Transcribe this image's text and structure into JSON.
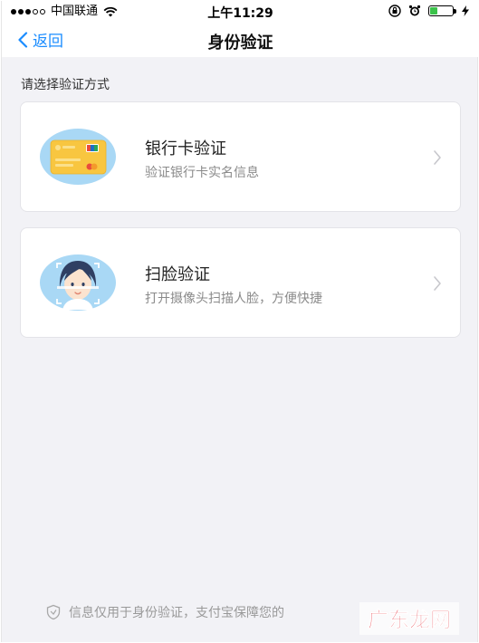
{
  "status_bar": {
    "carrier": "中国联通",
    "time": "上午11:29",
    "battery_level": 0.35,
    "icons": [
      "signal-icon",
      "wifi-icon",
      "orientation-lock-icon",
      "alarm-icon",
      "battery-icon",
      "charging-icon"
    ]
  },
  "nav": {
    "back_label": "返回",
    "title": "身份验证"
  },
  "section": {
    "label": "请选择验证方式"
  },
  "options": [
    {
      "title": "银行卡验证",
      "subtitle": "验证银行卡实名信息",
      "icon": "bank-card-icon"
    },
    {
      "title": "扫脸验证",
      "subtitle": "打开摄像头扫描人脸，方便快捷",
      "icon": "face-scan-icon"
    }
  ],
  "footer": {
    "note": "信息仅用于身份验证，支付宝保障您的",
    "icon": "shield-icon"
  },
  "watermark": {
    "text": "广东龙网"
  },
  "colors": {
    "accent": "#1a8cff",
    "background": "#f2f2f6",
    "card_bg": "#ffffff",
    "circle_bg": "#a9d8f5",
    "card_icon_yellow": "#f8c640",
    "watermark_red": "#e5303a"
  }
}
